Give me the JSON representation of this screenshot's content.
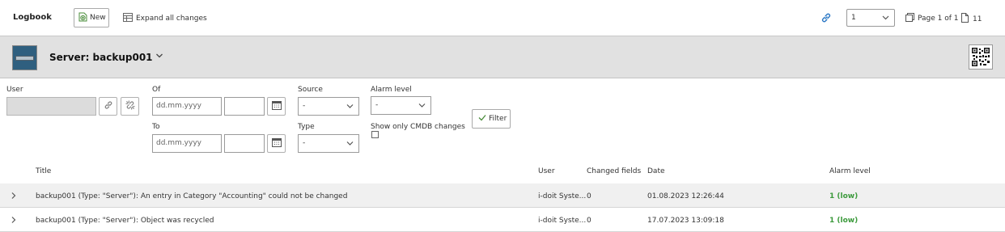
{
  "toolbar": {
    "title": "Logbook",
    "new_label": "New",
    "expand_label": "Expand all changes",
    "page_select_value": "1",
    "page_info": "Page 1 of 1",
    "entry_count": "11"
  },
  "object": {
    "title": "Server: backup001"
  },
  "filter": {
    "user_label": "User",
    "user_value": "",
    "of_label": "Of",
    "to_label": "To",
    "date_placeholder": "dd.mm.yyyy",
    "source_label": "Source",
    "source_value": "-",
    "type_label": "Type",
    "type_value": "-",
    "alarm_label": "Alarm level",
    "alarm_value": "-",
    "cmdb_only_label": "Show only CMDB changes",
    "filter_button": "Filter"
  },
  "table": {
    "columns": {
      "title": "Title",
      "user": "User",
      "changed_fields": "Changed fields",
      "date": "Date",
      "alarm_level": "Alarm level"
    },
    "rows": [
      {
        "title": "backup001 (Type: \"Server\"): An entry in Category \"Accounting\" could not be changed",
        "user": "i-doit Syste...",
        "changed_fields": "0",
        "date": "01.08.2023 12:26:44",
        "alarm_level": "1 (low)"
      },
      {
        "title": "backup001 (Type: \"Server\"): Object was recycled",
        "user": "i-doit Syste...",
        "changed_fields": "0",
        "date": "17.07.2023 13:09:18",
        "alarm_level": "1 (low)"
      }
    ]
  },
  "colors": {
    "header_bg": "#e1e1e1",
    "accent_link": "#2b78c5",
    "alarm_low": "#3c9a3c"
  },
  "icons": [
    "new-icon",
    "table-icon",
    "link-icon",
    "chevron-down-icon",
    "pages-icon",
    "document-icon",
    "server-image",
    "qr-code-icon",
    "unlink-icon",
    "calendar-icon",
    "checkmark-icon",
    "chevron-right-icon"
  ]
}
